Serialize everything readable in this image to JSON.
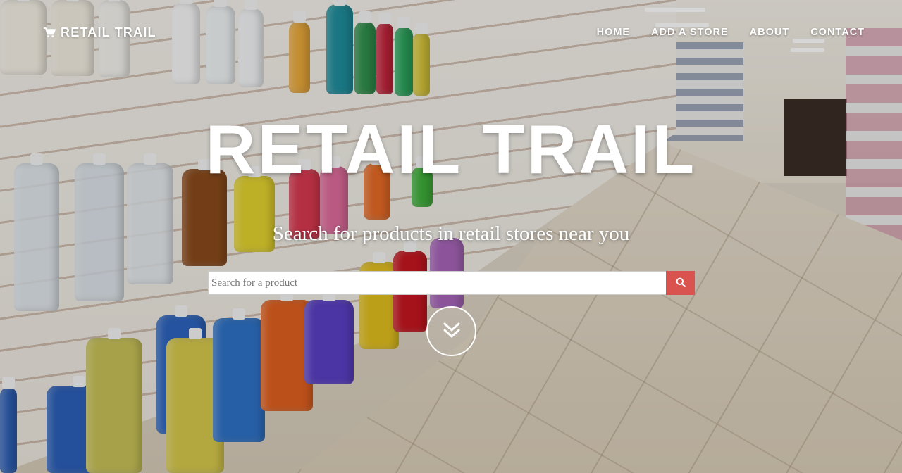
{
  "brand": {
    "name": "RETAIL TRAIL",
    "icon": "shopping-cart-icon"
  },
  "nav": {
    "items": [
      {
        "label": "HOME"
      },
      {
        "label": "ADD A STORE"
      },
      {
        "label": "ABOUT"
      },
      {
        "label": "CONTACT"
      }
    ]
  },
  "hero": {
    "title": "RETAIL TRAIL",
    "subtitle": "Search for products in retail stores near you",
    "background": "retail store aisle photo"
  },
  "search": {
    "placeholder": "Search for a product",
    "value": "",
    "button_icon": "search-icon"
  },
  "scroll_button": {
    "icon": "double-chevron-down-icon"
  },
  "colors": {
    "accent": "#d9534f",
    "text": "#ffffff"
  }
}
